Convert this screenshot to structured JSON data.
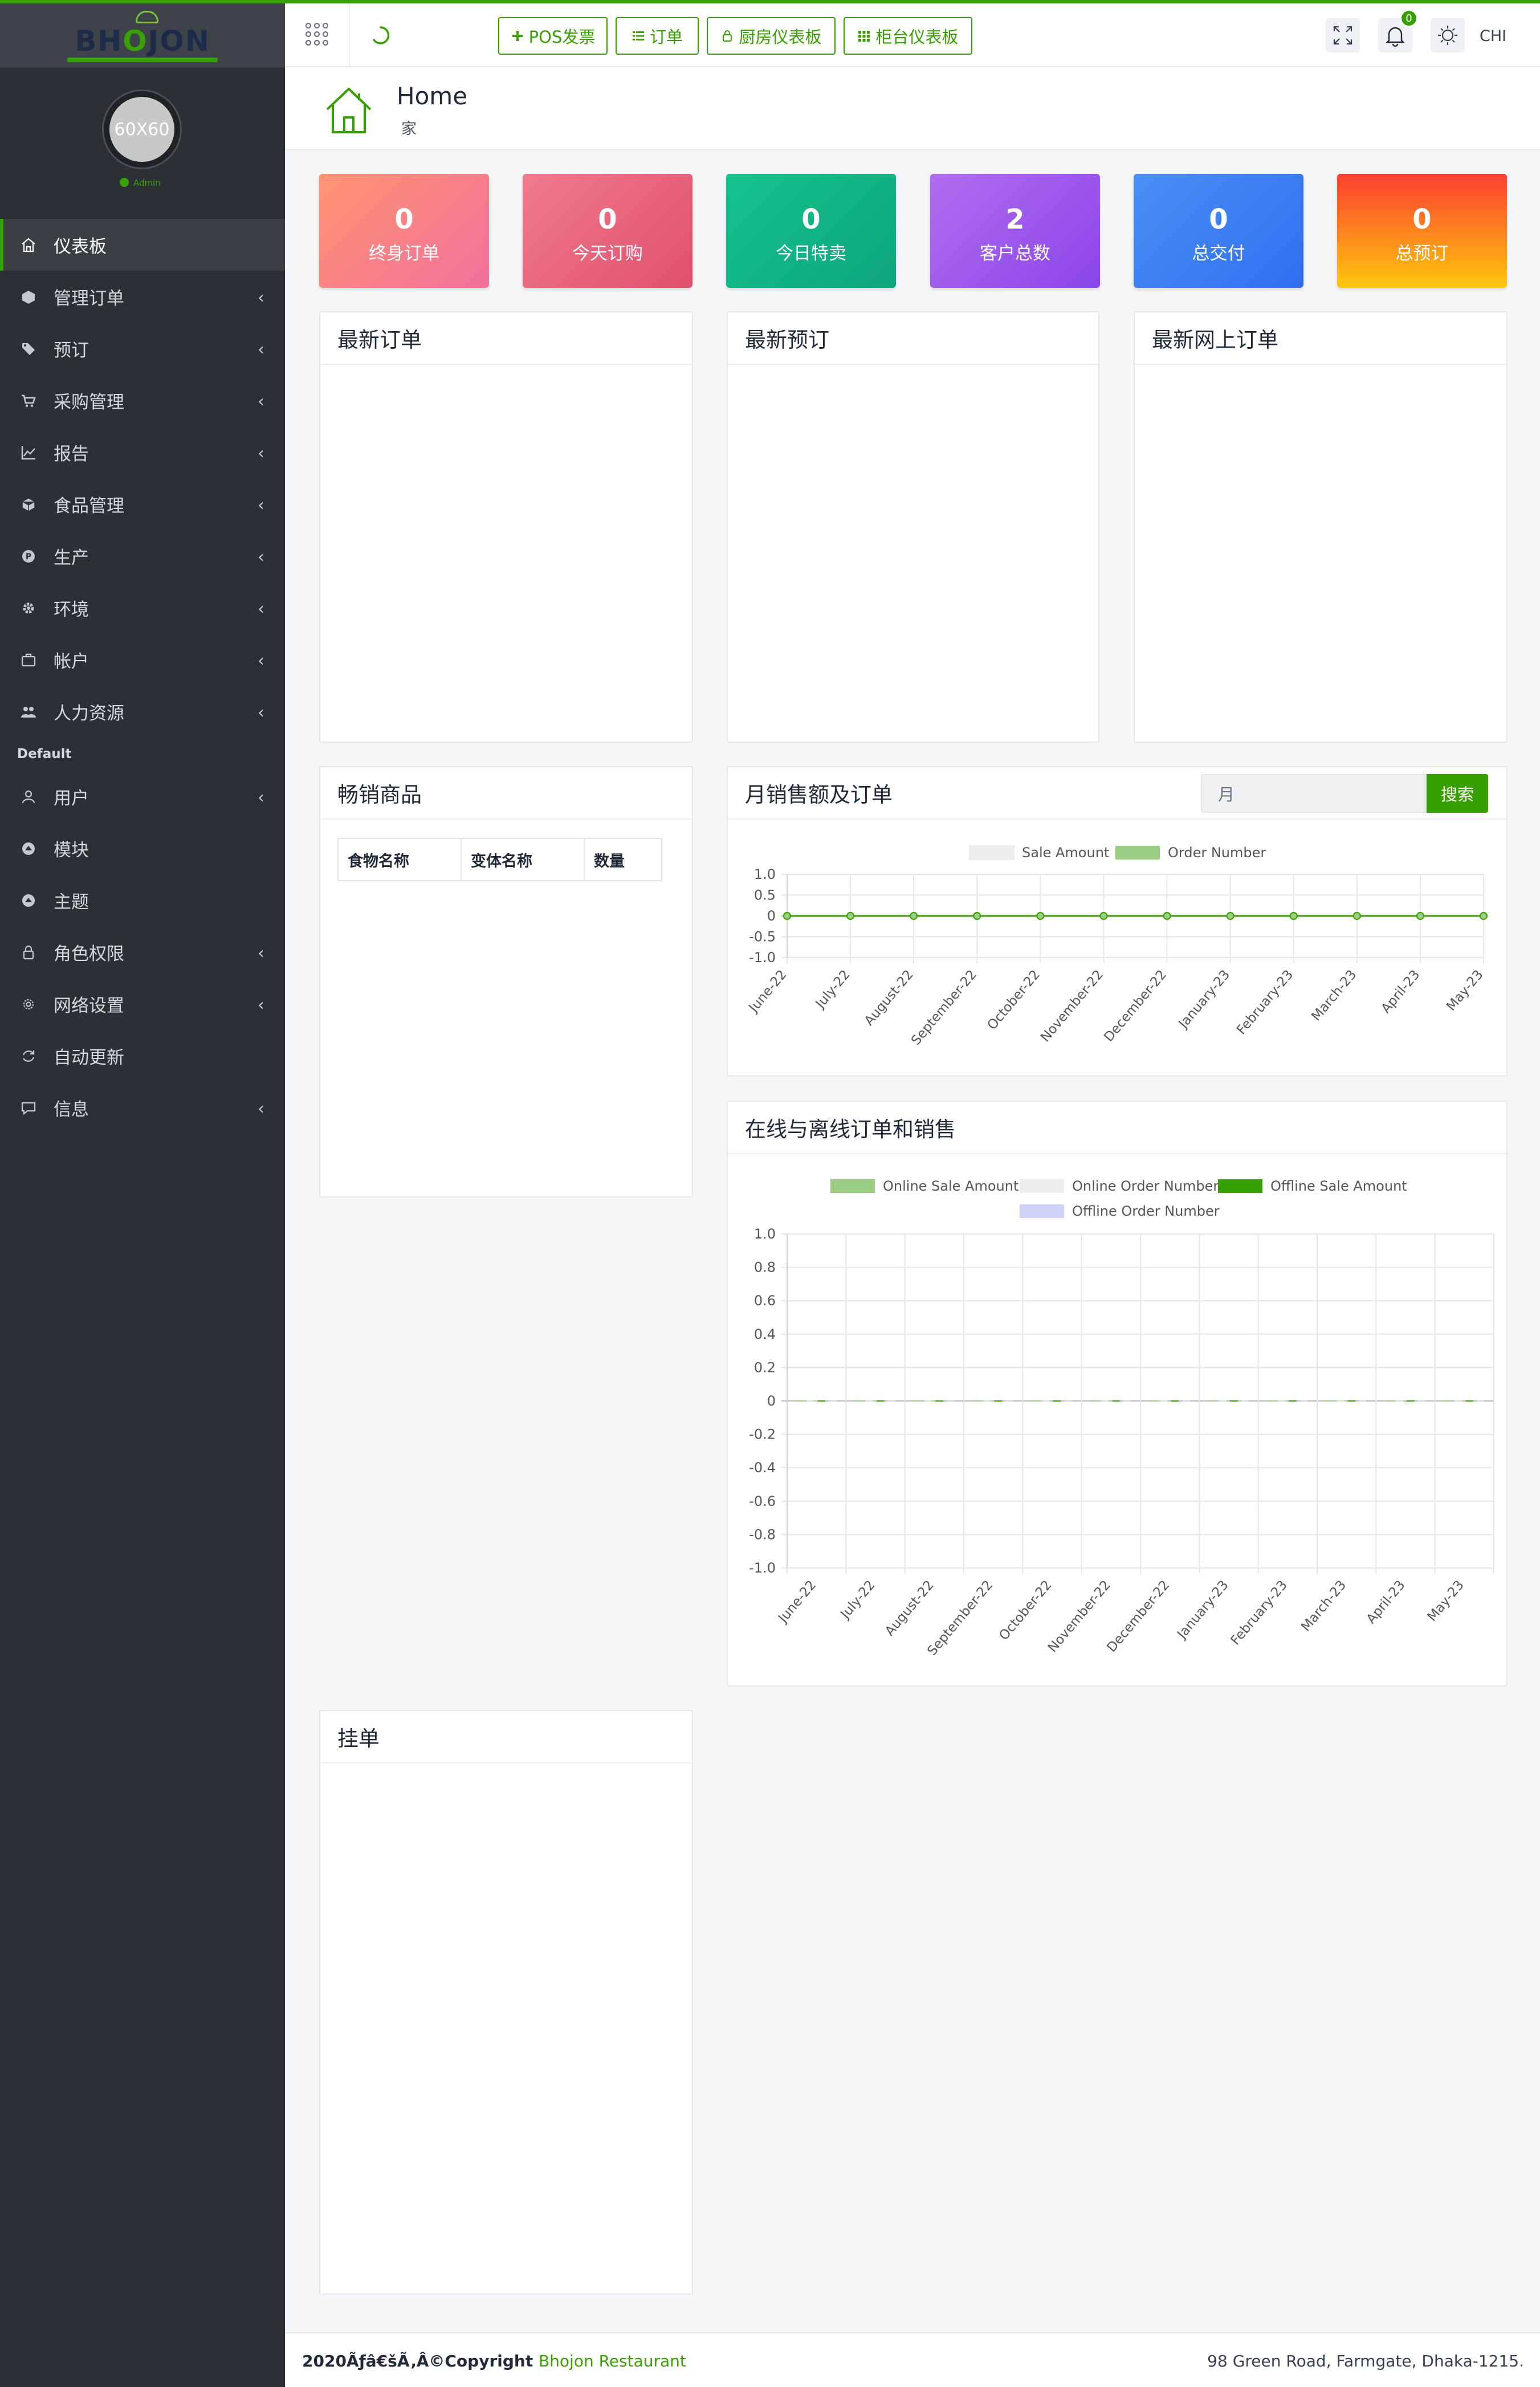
{
  "brand": {
    "logo_text": "BHOJON",
    "logo_colors": {
      "dark": "#1e2a4a",
      "accent": "#37a000"
    }
  },
  "user": {
    "avatar_text": "60X60",
    "role": "Admin"
  },
  "sidebar": {
    "items": [
      {
        "label": "仪表板",
        "icon": "home-icon",
        "active": true,
        "chevron": false
      },
      {
        "label": "管理订单",
        "icon": "cube-icon",
        "chevron": true
      },
      {
        "label": "预订",
        "icon": "tags-icon",
        "chevron": true
      },
      {
        "label": "采购管理",
        "icon": "cart-icon",
        "chevron": true
      },
      {
        "label": "报告",
        "icon": "chart-line-icon",
        "chevron": true
      },
      {
        "label": "食品管理",
        "icon": "box-icon",
        "chevron": true
      },
      {
        "label": "生产",
        "icon": "product-icon",
        "chevron": true
      },
      {
        "label": "环境",
        "icon": "gear-icon",
        "chevron": true
      },
      {
        "label": "帐户",
        "icon": "briefcase-icon",
        "chevron": true
      },
      {
        "label": "人力资源",
        "icon": "users-icon",
        "chevron": true
      }
    ],
    "section_label": "Default",
    "items2": [
      {
        "label": "用户",
        "icon": "user-icon",
        "chevron": true
      },
      {
        "label": "模块",
        "icon": "module-icon",
        "chevron": false
      },
      {
        "label": "主题",
        "icon": "theme-icon",
        "chevron": false
      },
      {
        "label": "角色权限",
        "icon": "lock-icon",
        "chevron": true
      },
      {
        "label": "网络设置",
        "icon": "settings-icon",
        "chevron": true
      },
      {
        "label": "自动更新",
        "icon": "refresh-icon",
        "chevron": false
      },
      {
        "label": "信息",
        "icon": "message-icon",
        "chevron": true
      }
    ]
  },
  "topbar": {
    "buttons": [
      {
        "label": "POS发票",
        "icon": "plus-icon"
      },
      {
        "label": "订单",
        "icon": "list-icon"
      },
      {
        "label": "厨房仪表板",
        "icon": "lock-icon"
      },
      {
        "label": "柜台仪表板",
        "icon": "grid-icon"
      }
    ],
    "notification_count": "0",
    "language": "CHI"
  },
  "page": {
    "title": "Home",
    "subtitle": "家"
  },
  "stats": [
    {
      "value": "0",
      "label": "终身订单",
      "color_from": "#ff9472",
      "color_to": "#f2709c"
    },
    {
      "value": "0",
      "label": "今天订购",
      "color_from": "#f07b8e",
      "color_to": "#e0506d"
    },
    {
      "value": "0",
      "label": "今日特卖",
      "color_from": "#14c38e",
      "color_to": "#0ea57a"
    },
    {
      "value": "2",
      "label": "客户总数",
      "color_from": "#b06ef0",
      "color_to": "#8a45e8"
    },
    {
      "value": "0",
      "label": "总交付",
      "color_from": "#4a90f5",
      "color_to": "#2f6ff0"
    },
    {
      "value": "0",
      "label": "总预订",
      "color_from": "#fd3f2f",
      "color_to": "#fdc70c"
    }
  ],
  "panels": {
    "latest_orders": "最新订单",
    "latest_reservations": "最新预订",
    "latest_online_orders": "最新网上订单",
    "bestsellers": "畅销商品",
    "monthly_sales": "月销售额及订单",
    "online_offline": "在线与离线订单和销售",
    "hold_orders": "挂单"
  },
  "bestsellers_table": {
    "headers": [
      "食物名称",
      "变体名称",
      "数量"
    ]
  },
  "search": {
    "placeholder": "月",
    "button": "搜索"
  },
  "chart_data": [
    {
      "type": "line",
      "title": "月销售额及订单",
      "categories": [
        "June-22",
        "July-22",
        "August-22",
        "September-22",
        "October-22",
        "November-22",
        "December-22",
        "January-23",
        "February-23",
        "March-23",
        "April-23",
        "May-23"
      ],
      "series": [
        {
          "name": "Sale Amount",
          "color": "#eeeeee",
          "values": [
            0,
            0,
            0,
            0,
            0,
            0,
            0,
            0,
            0,
            0,
            0,
            0
          ]
        },
        {
          "name": "Order Number",
          "color": "#9ccf85",
          "values": [
            0,
            0,
            0,
            0,
            0,
            0,
            0,
            0,
            0,
            0,
            0,
            0
          ]
        }
      ],
      "ylim": [
        -1.0,
        1.0
      ],
      "yticks": [
        "1.0",
        "0.5",
        "0",
        "-0.5",
        "-1.0"
      ],
      "grid": true,
      "legend": "top"
    },
    {
      "type": "bar",
      "title": "在线与离线订单和销售",
      "categories": [
        "June-22",
        "July-22",
        "August-22",
        "September-22",
        "October-22",
        "November-22",
        "December-22",
        "January-23",
        "February-23",
        "March-23",
        "April-23",
        "May-23"
      ],
      "series": [
        {
          "name": "Online Sale Amount",
          "color": "#9ccf85",
          "values": [
            0,
            0,
            0,
            0,
            0,
            0,
            0,
            0,
            0,
            0,
            0,
            0
          ]
        },
        {
          "name": "Online Order Number",
          "color": "#eeeeee",
          "values": [
            0,
            0,
            0,
            0,
            0,
            0,
            0,
            0,
            0,
            0,
            0,
            0
          ]
        },
        {
          "name": "Offline Sale Amount",
          "color": "#37a000",
          "values": [
            0,
            0,
            0,
            0,
            0,
            0,
            0,
            0,
            0,
            0,
            0,
            0
          ]
        },
        {
          "name": "Offline Order Number",
          "color": "#cfd3f7",
          "values": [
            0,
            0,
            0,
            0,
            0,
            0,
            0,
            0,
            0,
            0,
            0,
            0
          ]
        }
      ],
      "ylim": [
        -1.0,
        1.0
      ],
      "yticks": [
        "1.0",
        "0.8",
        "0.6",
        "0.4",
        "0.2",
        "0",
        "-0.2",
        "-0.4",
        "-0.6",
        "-0.8",
        "-1.0"
      ],
      "grid": true,
      "legend": "top"
    }
  ],
  "footer": {
    "copyright": "2020Ãƒâ€šÃ‚Â©Copyright",
    "brand": "Bhojon Restaurant",
    "address": "98 Green Road, Farmgate, Dhaka-1215."
  }
}
